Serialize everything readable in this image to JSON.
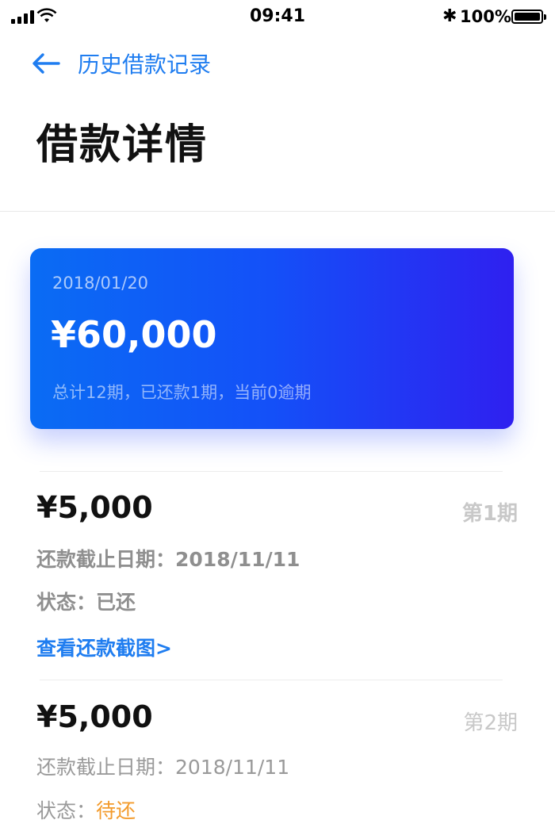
{
  "status_bar": {
    "time": "09:41",
    "battery_pct": "100%",
    "battery_level": 1.0,
    "bluetooth": "bluetooth-icon"
  },
  "nav": {
    "back_icon": "arrow-left-icon",
    "title": "历史借款记录"
  },
  "page": {
    "title": "借款详情"
  },
  "summary_card": {
    "date": "2018/01/20",
    "amount": "¥60,000",
    "summary": "总计12期，已还款1期，当前0逾期"
  },
  "bills": [
    {
      "amount": "¥5,000",
      "period": "第1期",
      "due_label": "还款截止日期：",
      "due_date": "2018/11/11",
      "status_label": "状态：",
      "status": "已还",
      "link": "查看还款截图>"
    },
    {
      "amount": "¥5,000",
      "period": "第2期",
      "due_label": "还款截止日期：",
      "due_date": "2018/11/11",
      "status_label": "状态：",
      "status": "待还"
    }
  ],
  "colors": {
    "accent": "#1f7df0",
    "pending": "#f39b2c",
    "card_gradient_start": "#0a6cf4",
    "card_gradient_end": "#2f20f0"
  }
}
